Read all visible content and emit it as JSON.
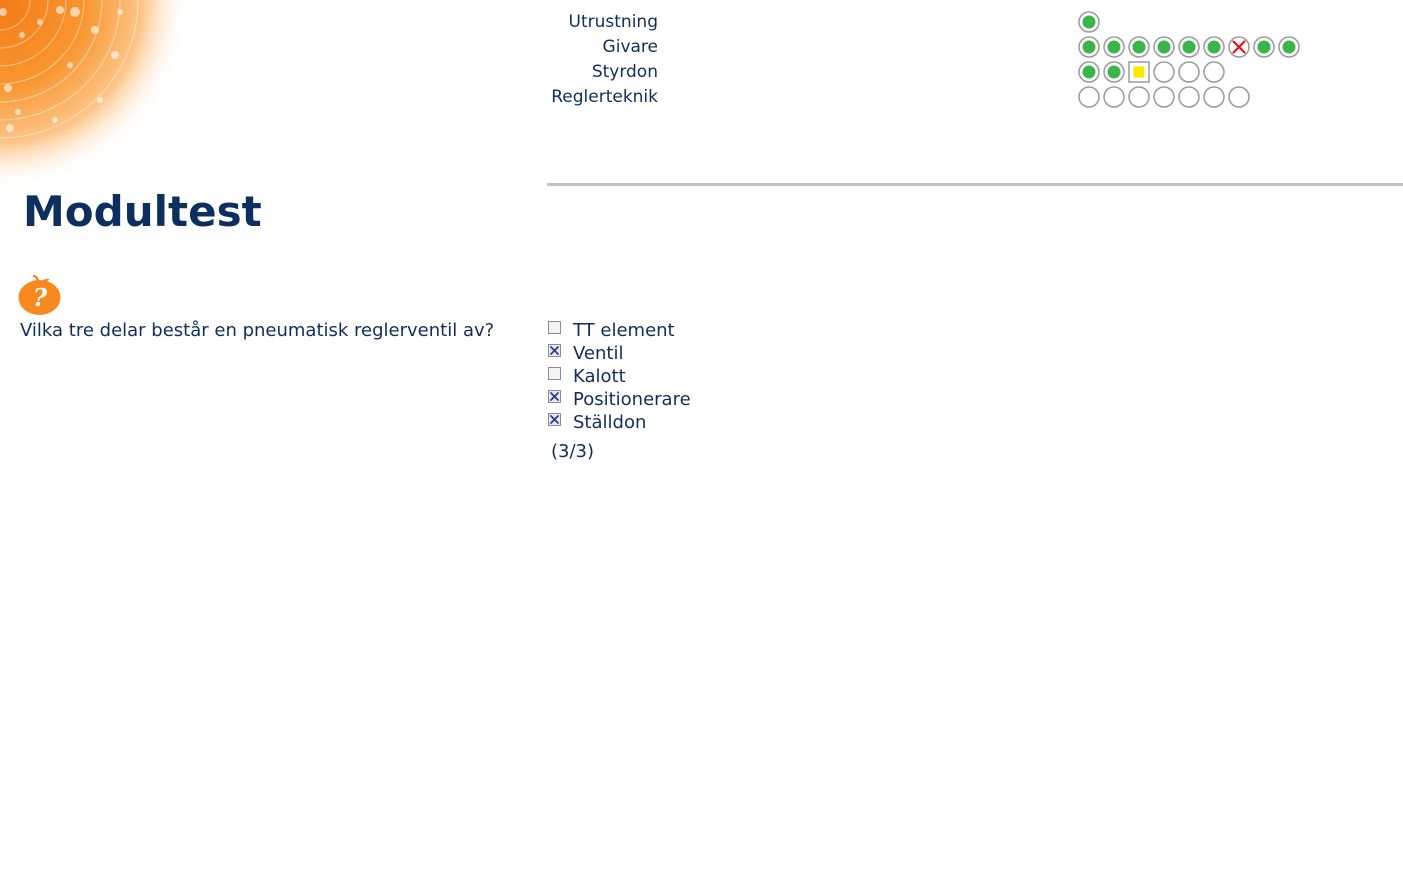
{
  "progress": {
    "rows": [
      {
        "label": "Utrustning",
        "states": [
          "ok"
        ]
      },
      {
        "label": "Givare",
        "states": [
          "ok",
          "ok",
          "ok",
          "ok",
          "ok",
          "ok",
          "wrong",
          "ok",
          "ok"
        ]
      },
      {
        "label": "Styrdon",
        "states": [
          "ok",
          "ok",
          "current",
          "empty",
          "empty",
          "empty"
        ]
      },
      {
        "label": "Reglerteknik",
        "states": [
          "empty",
          "empty",
          "empty",
          "empty",
          "empty",
          "empty",
          "empty"
        ]
      }
    ],
    "colors": {
      "ok": "#3bb54a",
      "wrong": "#e2111d",
      "current": "#ffe600",
      "ring": "#9a9a9a"
    }
  },
  "page": {
    "title": "Modultest"
  },
  "help_icon": "question-apple-icon",
  "question": {
    "text": "Vilka tre delar består en pneumatisk reglerventil av?",
    "options": [
      {
        "label": "TT element",
        "checked": false
      },
      {
        "label": "Ventil",
        "checked": true
      },
      {
        "label": "Kalott",
        "checked": false
      },
      {
        "label": "Positionerare",
        "checked": true
      },
      {
        "label": "Ställdon",
        "checked": true
      }
    ],
    "score": "(3/3)"
  },
  "colors": {
    "text": "#0d2f5e",
    "accent": "#f7891e",
    "rule": "#c2c2c2"
  }
}
